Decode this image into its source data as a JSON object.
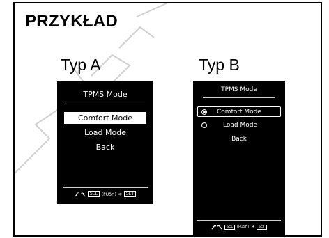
{
  "heading": "PRZYKŁAD",
  "type_a": {
    "label": "Typ A",
    "screen_title": "TPMS Mode",
    "items": [
      "Comfort Mode",
      "Load Mode",
      "Back"
    ],
    "selected_item": "Comfort Mode",
    "footer": {
      "sel": "SEL",
      "push": "(PUSH)",
      "set": "SET"
    }
  },
  "type_b": {
    "label": "Typ B",
    "screen_title": "TPMS Mode",
    "items": [
      "Comfort Mode",
      "Load Mode",
      "Back"
    ],
    "selected_item": "Comfort Mode",
    "footer": {
      "sel": "SEL",
      "push": "(PUSH)",
      "set": "SET"
    }
  },
  "colors": {
    "screen_bg": "#000000",
    "screen_text": "#ffffff",
    "frame": "#000000"
  }
}
